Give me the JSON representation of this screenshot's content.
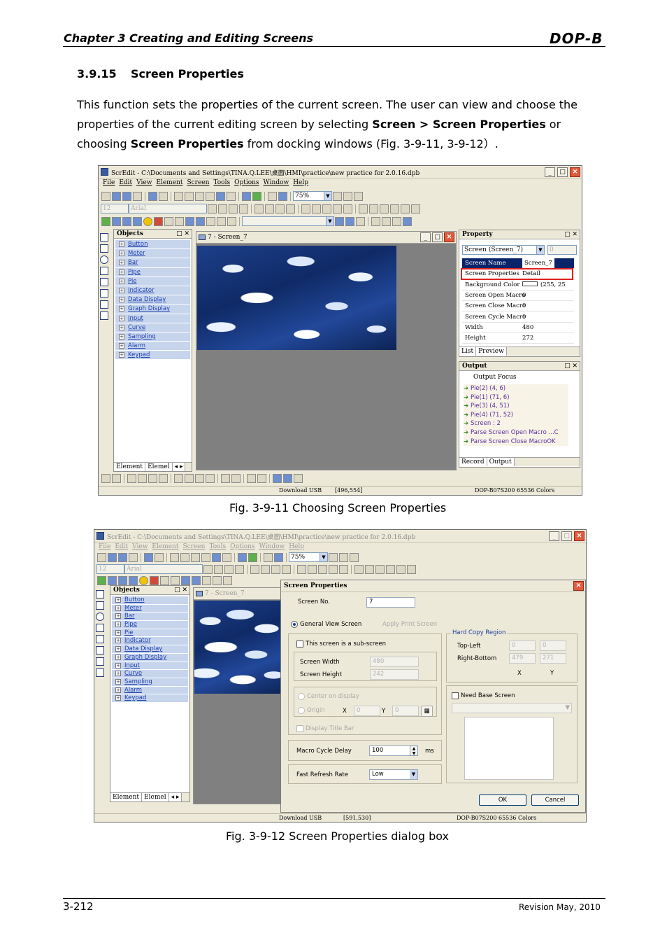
{
  "header": {
    "chapter_title": "Chapter 3 Creating and Editing Screens",
    "logo": "DOP-B"
  },
  "section": {
    "number": "3.9.15",
    "title": "Screen Properties"
  },
  "paragraph": {
    "part1": "This function sets the properties of the current screen. The user can view and choose the properties of the current editing screen by selecting ",
    "bold1": "Screen > Screen Properties",
    "part2": " or choosing ",
    "bold2": "Screen Properties",
    "part3": " from docking windows (Fig. 3-9-11, 3-9-12）."
  },
  "fig1": {
    "caption": "Fig. 3-9-11 Choosing Screen Properties",
    "window_title": "ScrEdit - C:\\Documents and Settings\\TINA.Q.LEE\\桌面\\HMI\\practice\\new practice for 2.0.16.dpb",
    "menu": [
      "File",
      "Edit",
      "View",
      "Element",
      "Screen",
      "Tools",
      "Options",
      "Window",
      "Help"
    ],
    "zoom": "75%",
    "font_combo": "Arial",
    "font_size_combo": "12",
    "objects_panel": {
      "title": "Objects",
      "items": [
        "Button",
        "Meter",
        "Bar",
        "Pipe",
        "Pie",
        "Indicator",
        "Data Display",
        "Graph Display",
        "Input",
        "Curve",
        "Sampling",
        "Alarm",
        "Keypad"
      ],
      "tabs": [
        "Element",
        "Elemel"
      ]
    },
    "doc_title": "7 - Screen_7",
    "property_panel": {
      "title": "Property",
      "selector": "Screen (Screen_7)",
      "rows": [
        {
          "key": "Screen Name",
          "value": "Screen_7"
        },
        {
          "key": "Screen Properties",
          "value": "Detail"
        },
        {
          "key": "Background Color",
          "value": "(255, 25"
        },
        {
          "key": "Screen Open Macro",
          "value": "0"
        },
        {
          "key": "Screen Close Macro",
          "value": "0"
        },
        {
          "key": "Screen Cycle Macro",
          "value": "0"
        },
        {
          "key": "Width",
          "value": "480"
        },
        {
          "key": "Height",
          "value": "272"
        }
      ],
      "tabs": [
        "List",
        "Preview"
      ]
    },
    "output_panel": {
      "title": "Output",
      "focus_label": "Output Focus",
      "rows": [
        "Pie(2) (4, 6)",
        "Pie(1) (71, 6)",
        "Pie(3) (4, 51)",
        "Pie(4) (71, 52)",
        "Screen : 2",
        "Parse Screen Open Macro ...C",
        "Parse Screen Close MacroOK"
      ],
      "tabs": [
        "Record",
        "Output"
      ]
    },
    "status": {
      "connection": "Download USB",
      "coords": "[496,554]",
      "model": "DOP-B07S200 65536 Colors"
    }
  },
  "fig2": {
    "caption": "Fig. 3-9-12 Screen Properties dialog box",
    "window_title": "ScrEdit - C:\\Documents and Settings\\TINA.Q.LEE\\桌面\\HMI\\practice\\new practice for 2.0.16.dpb",
    "menu": [
      "File",
      "Edit",
      "View",
      "Element",
      "Screen",
      "Tools",
      "Options",
      "Window",
      "Help"
    ],
    "zoom": "75%",
    "font_combo": "Arial",
    "font_size_combo": "12",
    "objects_panel": {
      "title": "Objects",
      "items": [
        "Button",
        "Meter",
        "Bar",
        "Pipe",
        "Pie",
        "Indicator",
        "Data Display",
        "Graph Display",
        "Input",
        "Curve",
        "Sampling",
        "Alarm",
        "Keypad"
      ],
      "tabs": [
        "Element",
        "Elemel"
      ]
    },
    "doc_title": "7 - Screen_7",
    "status": {
      "connection": "Download USB",
      "coords": "[591,530]",
      "model": "DOP-B07S200 65536 Colors"
    },
    "dialog": {
      "title": "Screen Properties",
      "screen_no_label": "Screen No.",
      "screen_no_value": "7",
      "general_view": "General View Screen",
      "apply_print": "Apply Print Screen",
      "sub_screen": "This screen is a sub-screen",
      "width_label": "Screen Width",
      "width_value": "480",
      "height_label": "Screen Height",
      "height_value": "242",
      "center_display": "Center on display",
      "origin_label": "Origin",
      "x_label": "X",
      "x_value": "0",
      "y_label": "Y",
      "y_value": "0",
      "display_title_bar": "Display Title Bar",
      "hard_copy_title": "Hard Copy Region",
      "top_left": "Top-Left",
      "top_left_x": "0",
      "top_left_y": "0",
      "right_bottom": "Right-Bottom",
      "right_bottom_x": "479",
      "right_bottom_y": "271",
      "col_x": "X",
      "col_y": "Y",
      "need_base": "Need Base Screen",
      "macro_label": "Macro Cycle Delay",
      "macro_value": "100",
      "macro_unit": "ms",
      "refresh_label": "Fast Refresh Rate",
      "refresh_value": "Low",
      "ok": "OK",
      "cancel": "Cancel"
    }
  },
  "footer": {
    "page": "3-212",
    "revision": "Revision May, 2010"
  },
  "colors": {
    "highlight": "#e0201e",
    "object_row": "#c6d4ec",
    "object_text": "#1b3fb0",
    "window_face": "#ece9d8"
  }
}
